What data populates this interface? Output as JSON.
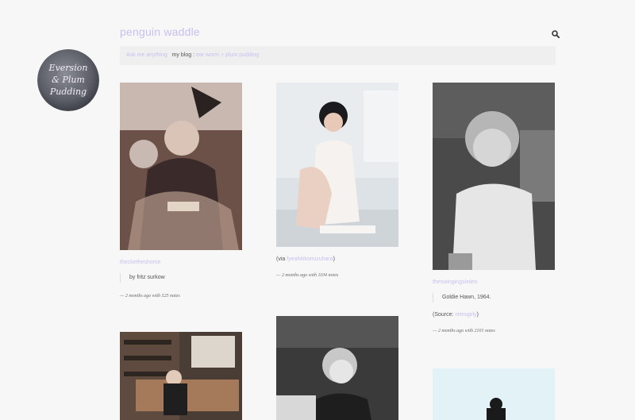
{
  "blog": {
    "title": "penguin waddle",
    "avatar_text": "Eversion & Plum Pudding"
  },
  "nav": {
    "ask_label": "Ask me anything",
    "myblog_label": "my blog",
    "separator": ":",
    "blog_link": "ear worm + plum pudding"
  },
  "posts": [
    {
      "source": "thecketheshorse",
      "caption": "by fritz surkow",
      "meta": "— 2 months ago with 525 notes"
    },
    {
      "via_prefix": "(via",
      "via_link": "fyeahkikomizuhara",
      "via_suffix": ")",
      "meta": "— 2 months ago with 1104 notes"
    },
    {
      "source": "theswingingsixties",
      "caption": "Goldie Hawn, 1964.",
      "source_prefix": "(Source:",
      "source_link": "retrogirly",
      "source_suffix": ")",
      "meta": "— 2 months ago with 2101 notes"
    }
  ],
  "colors": {
    "accent": "#c9bff0",
    "background": "#f7f7f7",
    "nav_bg": "#efefef"
  },
  "icons": {
    "search": "search-icon"
  }
}
